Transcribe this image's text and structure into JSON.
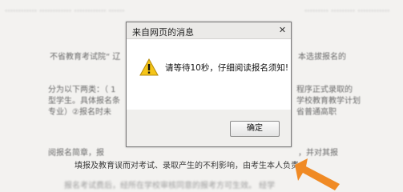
{
  "background": {
    "lines": [
      "不省教育考试院“ 辽",
      "本选拔报名的",
      "分为以下两类：（ 1",
      "程序正式录取的",
      "型学生。具体报名条",
      "学校教育教学计划",
      "专业）②报名时未",
      "省普通高职",
      "阅报名简章，报",
      "，并对其报",
      "填报及教育误而对考试、录取产生的不利影响，由考生本人负责。",
      "报名考试费后，经所在学校审核同意的报考方可生效。 经学"
    ]
  },
  "dialog": {
    "title": "来自网页的消息",
    "close_symbol": "✕",
    "message": "请等待10秒，仔细阅读报名须知!",
    "ok_label": "确定",
    "warning_color": "#f5c518"
  },
  "arrow": {
    "color": "#f08a24"
  }
}
